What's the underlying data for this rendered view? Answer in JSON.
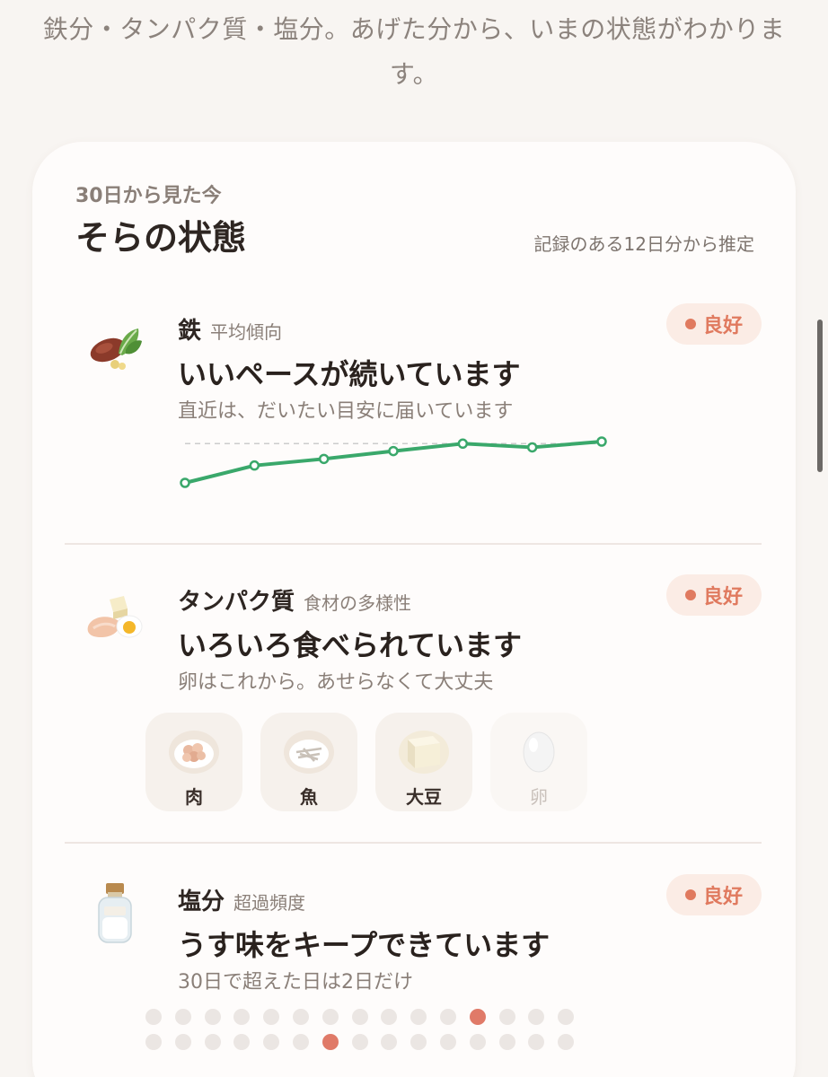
{
  "intro_text": "鉄分・タンパク質・塩分。あげた分から、いまの状態がわかります。",
  "card": {
    "subtitle": "30日から見た今",
    "title": "そらの状態",
    "note": "記録のある12日分から推定"
  },
  "iron": {
    "label": "鉄",
    "sub": "平均傾向",
    "headline": "いいペースが続いています",
    "desc": "直近は、だいたい目安に届いています",
    "status": "良好",
    "icon": "liver-spinach-icon",
    "chart_data": {
      "type": "line",
      "values": [
        0.0,
        0.42,
        0.58,
        0.77,
        0.95,
        0.86,
        1.0
      ],
      "target": 0.95,
      "line_color": "#3aa86b",
      "target_color": "#cccccc"
    }
  },
  "protein": {
    "label": "タンパク質",
    "sub": "食材の多様性",
    "headline": "いろいろ食べられています",
    "desc": "卵はこれから。あせらなくて大丈夫",
    "status": "良好",
    "icon": "chicken-tofu-egg-icon",
    "foods": [
      {
        "name": "肉",
        "icon": "meat-bowl-icon",
        "eaten": true
      },
      {
        "name": "魚",
        "icon": "fish-bowl-icon",
        "eaten": true
      },
      {
        "name": "大豆",
        "icon": "tofu-icon",
        "eaten": true
      },
      {
        "name": "卵",
        "icon": "egg-icon",
        "eaten": false
      }
    ]
  },
  "salt": {
    "label": "塩分",
    "sub": "超過頻度",
    "headline": "うす味をキープできています",
    "desc": "30日で超えた日は2日だけ",
    "status": "良好",
    "icon": "salt-jar-icon",
    "days_total": 30,
    "exceeded_days": [
      12,
      22
    ],
    "hit_color": "#e07a68"
  }
}
